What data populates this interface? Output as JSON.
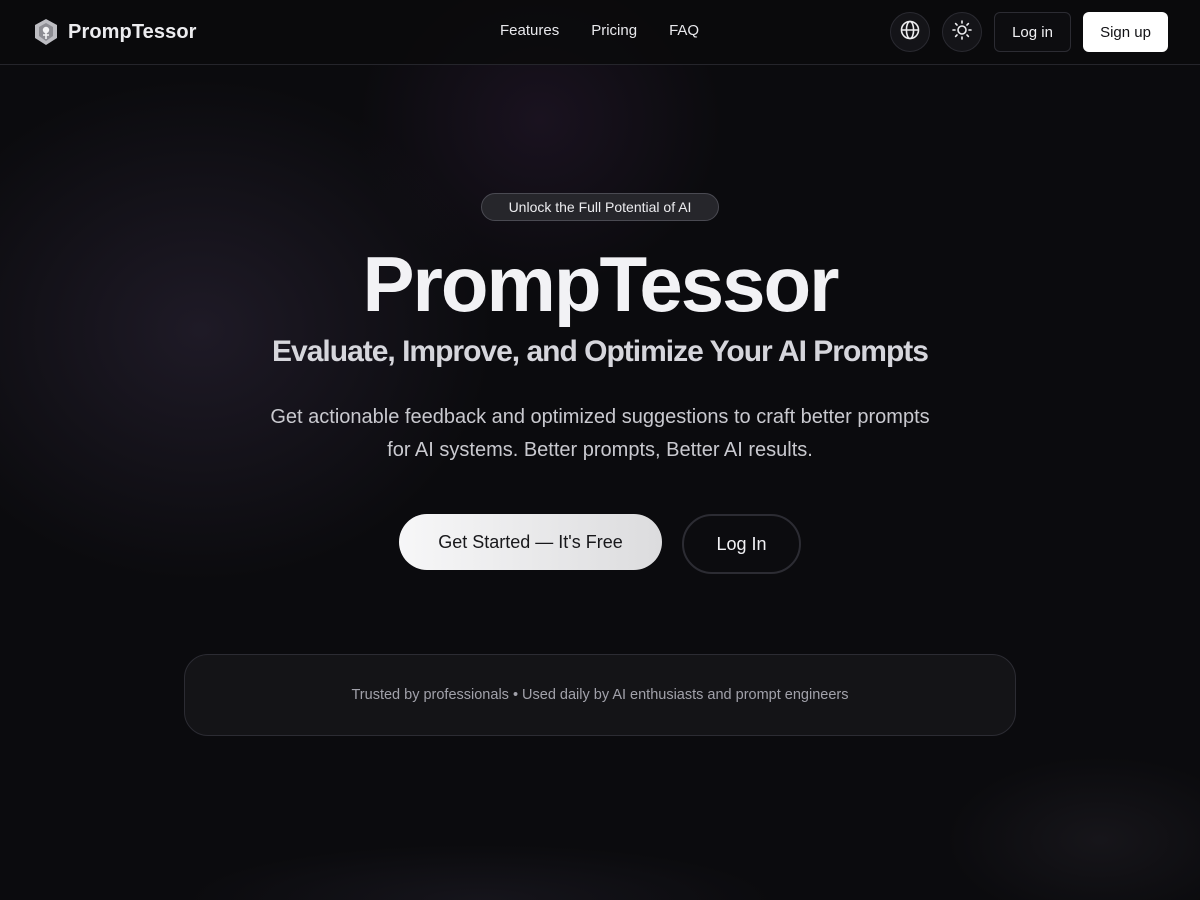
{
  "brand": {
    "name": "PrompTessor",
    "logo_icon": "shield-logo-icon"
  },
  "nav": {
    "items": [
      {
        "label": "Features"
      },
      {
        "label": "Pricing"
      },
      {
        "label": "FAQ"
      }
    ]
  },
  "header_actions": {
    "language_icon": "globe-icon",
    "theme_icon": "sun-icon",
    "login_label": "Log in",
    "signup_label": "Sign up"
  },
  "hero": {
    "badge": "Unlock the Full Potential of AI",
    "title": "PrompTessor",
    "subtitle": "Evaluate, Improve, and Optimize Your AI Prompts",
    "description": "Get actionable feedback and optimized suggestions to craft better prompts for AI systems. Better prompts, Better AI results.",
    "cta_primary": "Get Started — It's Free",
    "cta_secondary": "Log In"
  },
  "trust_bar": {
    "text": "Trusted by professionals • Used daily by AI enthusiasts and prompt engineers"
  },
  "colors": {
    "background": "#0b0b0e",
    "accent_light": "#ffffff",
    "muted_text": "#a1a1aa"
  }
}
